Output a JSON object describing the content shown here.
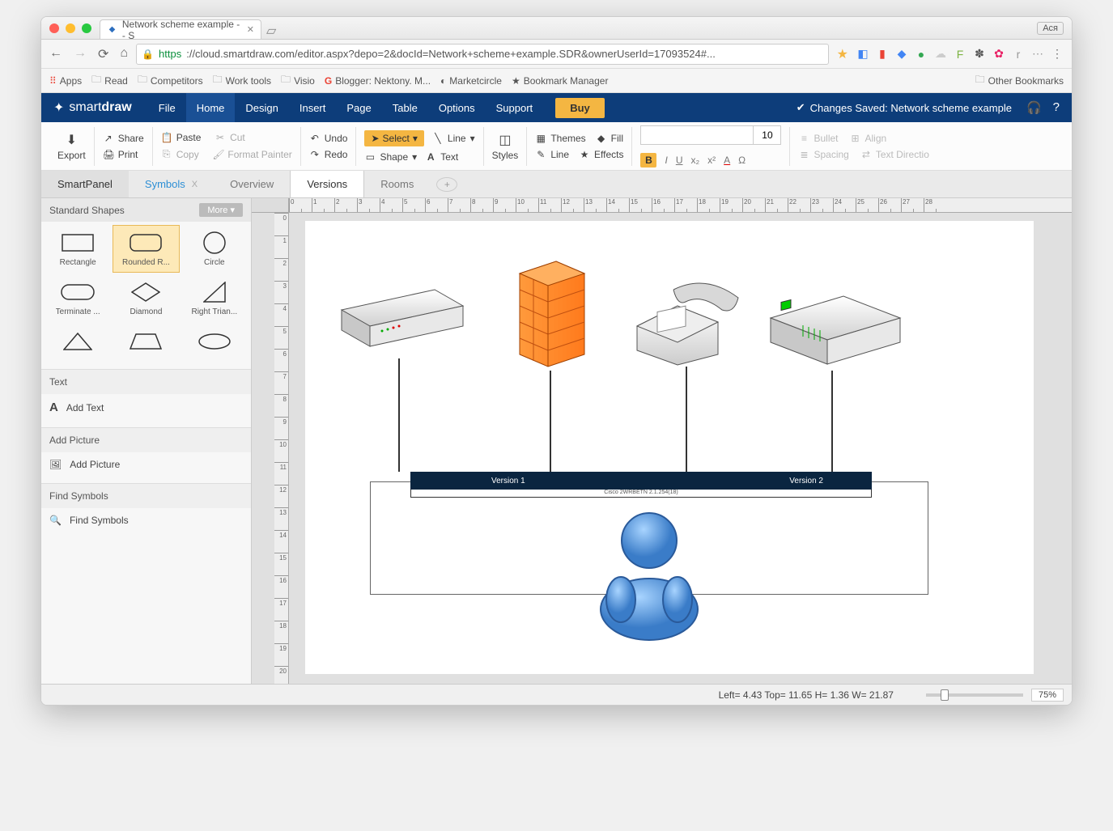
{
  "browser": {
    "tab_title": "Network scheme example -- S",
    "user_chip": "Ася",
    "url_https": "https",
    "url_rest": "://cloud.smartdraw.com/editor.aspx?depo=2&docId=Network+scheme+example.SDR&ownerUserId=17093524#...",
    "bookmarks": [
      "Apps",
      "Read",
      "Competitors",
      "Work tools",
      "Visio",
      "Blogger: Nektony. M...",
      "Marketcircle",
      "Bookmark Manager"
    ],
    "other_bookmarks": "Other Bookmarks"
  },
  "app": {
    "logo1": "smart",
    "logo2": "draw",
    "menu": [
      "File",
      "Home",
      "Design",
      "Insert",
      "Page",
      "Table",
      "Options",
      "Support"
    ],
    "active_menu": "Home",
    "buy": "Buy",
    "save_status": "Changes Saved: Network scheme example"
  },
  "ribbon": {
    "export": "Export",
    "share": "Share",
    "print": "Print",
    "paste": "Paste",
    "cut": "Cut",
    "copy": "Copy",
    "format_painter": "Format Painter",
    "undo": "Undo",
    "redo": "Redo",
    "select": "Select",
    "line": "Line",
    "shape": "Shape",
    "text": "Text",
    "styles": "Styles",
    "themes": "Themes",
    "fill": "Fill",
    "line2": "Line",
    "effects": "Effects",
    "font_size": "10",
    "bullet": "Bullet",
    "spacing": "Spacing",
    "align": "Align",
    "direction": "Text Directio"
  },
  "tabs": {
    "smartpanel": "SmartPanel",
    "symbols": "Symbols",
    "overview": "Overview",
    "versions": "Versions",
    "rooms": "Rooms"
  },
  "panel": {
    "shapes_hdr": "Standard Shapes",
    "more": "More",
    "shapes": [
      "Rectangle",
      "Rounded R...",
      "Circle",
      "Terminate ...",
      "Diamond",
      "Right Trian..."
    ],
    "text_hdr": "Text",
    "add_text": "Add Text",
    "pic_hdr": "Add Picture",
    "add_pic": "Add Picture",
    "find_hdr": "Find Symbols",
    "find": "Find Symbols"
  },
  "diagram": {
    "v1": "Version 1",
    "v2": "Version 2",
    "sub": "Cisco 2WRBETN 2.1.254(18)"
  },
  "status": {
    "coords": "Left= 4.43 Top= 11.65 H= 1.36 W= 21.87",
    "zoom": "75%"
  }
}
